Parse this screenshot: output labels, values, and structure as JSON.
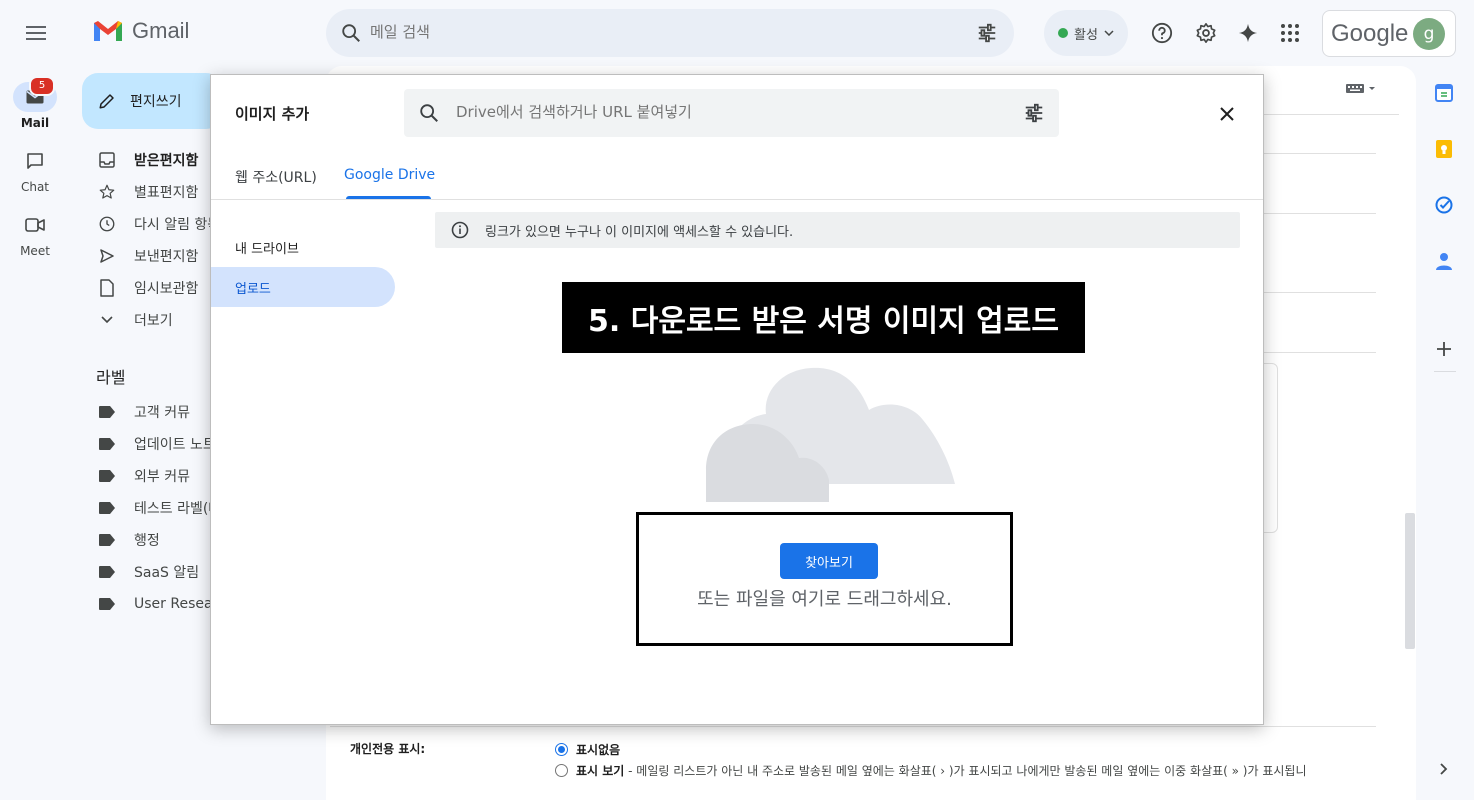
{
  "header": {
    "logo_text": "Gmail",
    "search_placeholder": "메일 검색",
    "status_label": "활성",
    "account_text": "Google",
    "avatar_letter": "g"
  },
  "rail": {
    "mail_label": "Mail",
    "mail_badge": "5",
    "chat_label": "Chat",
    "meet_label": "Meet"
  },
  "nav": {
    "compose_label": "편지쓰기",
    "items": [
      {
        "label": "받은편지함"
      },
      {
        "label": "별표편지함"
      },
      {
        "label": "다시 알림 항목"
      },
      {
        "label": "보낸편지함"
      },
      {
        "label": "임시보관함"
      },
      {
        "label": "더보기"
      }
    ],
    "labels_header": "라벨",
    "labels": [
      {
        "label": "고객 커뮤"
      },
      {
        "label": "업데이트 노트"
      },
      {
        "label": "외부 커뮤"
      },
      {
        "label": "테스트 라벨(테"
      },
      {
        "label": "행정"
      },
      {
        "label": "SaaS 알림"
      },
      {
        "label": "User Research"
      }
    ]
  },
  "settings": {
    "personal_label": "개인전용 표시:",
    "option_none": "표시없음",
    "option_show_bold": "표시 보기",
    "option_show_desc": " - 메일링 리스트가 아닌 내 주소로 발송된 메일 옆에는 화살표( › )가 표시되고 나에게만 발송된 메일 옆에는 이중 화살표( » )가 표시됩니"
  },
  "dialog": {
    "title": "이미지 추가",
    "search_placeholder": "Drive에서 검색하거나 URL 붙여넣기",
    "tabs": [
      {
        "label": "웹 주소(URL)"
      },
      {
        "label": "Google Drive"
      }
    ],
    "nav": [
      {
        "label": "내 드라이브"
      },
      {
        "label": "업로드"
      }
    ],
    "notice": "링크가 있으면 누구나 이 이미지에 액세스할 수 있습니다.",
    "banner": "5. 다운로드 받은 서명 이미지 업로드",
    "browse_label": "찾아보기",
    "drag_text": "또는 파일을 여기로 드래그하세요."
  },
  "colors": {
    "accent": "#1a73e8",
    "compose_bg": "#c2e7ff",
    "active_nav": "#d3e3fd",
    "badge": "#d93025"
  }
}
